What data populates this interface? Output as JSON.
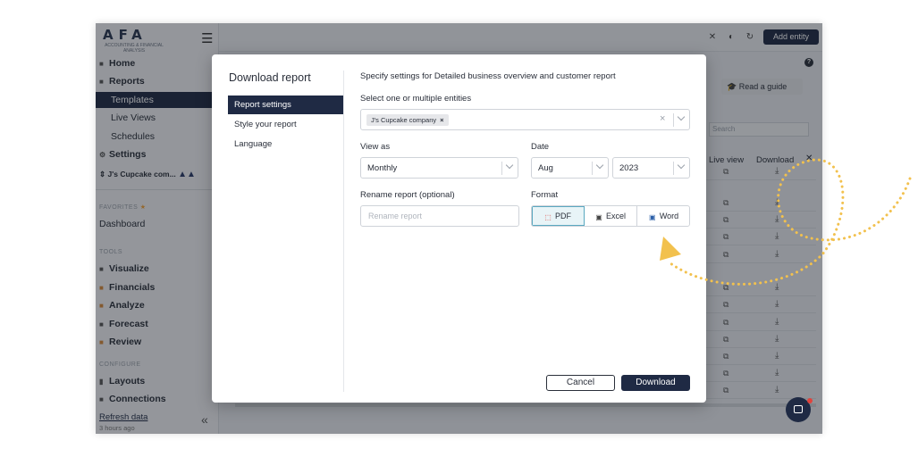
{
  "sidebar": {
    "logo": "AFA",
    "logo_sub": "ACCOUNTING & FINANCIAL ANALYSIS",
    "items": {
      "home": "Home",
      "reports": "Reports",
      "templates": "Templates",
      "live_views": "Live Views",
      "schedules": "Schedules",
      "settings": "Settings"
    },
    "entity": "J's Cupcake com...",
    "favorites_label": "FAVORITES",
    "dashboard": "Dashboard",
    "tools_label": "TOOLS",
    "tools": {
      "visualize": "Visualize",
      "financials": "Financials",
      "analyze": "Analyze",
      "forecast": "Forecast",
      "review": "Review"
    },
    "configure_label": "CONFIGURE",
    "configure": {
      "layouts": "Layouts",
      "connections": "Connections"
    },
    "refresh": "Refresh data",
    "refresh_time": "3 hours ago"
  },
  "topbar": {
    "add_entity": "Add entity"
  },
  "background": {
    "guide": "Read a guide",
    "search_placeholder": "Search",
    "col_live_view": "Live view",
    "col_download": "Download"
  },
  "modal": {
    "title": "Download report",
    "nav": {
      "report_settings": "Report settings",
      "style": "Style your report",
      "language": "Language"
    },
    "spec": "Specify settings for Detailed business overview and customer report",
    "entities_label": "Select one or multiple entities",
    "entity_chip": "J's Cupcake company",
    "view_as_label": "View as",
    "view_as_value": "Monthly",
    "date_label": "Date",
    "month_value": "Aug",
    "year_value": "2023",
    "rename_label": "Rename report (optional)",
    "rename_placeholder": "Rename report",
    "format_label": "Format",
    "formats": {
      "pdf": "PDF",
      "excel": "Excel",
      "word": "Word"
    },
    "selected_format": "PDF",
    "cancel": "Cancel",
    "download": "Download"
  },
  "colors": {
    "primary": "#1f2a44",
    "annotation": "#f2c14e",
    "format_active": "#5aa8c0"
  }
}
